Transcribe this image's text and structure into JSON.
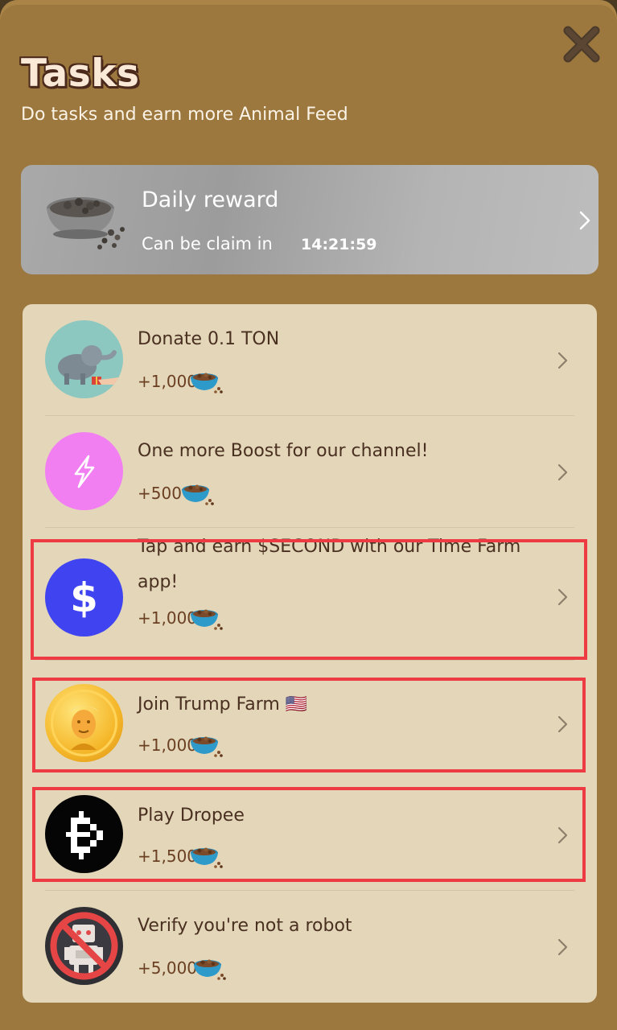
{
  "header": {
    "title": "Tasks",
    "subtitle": "Do tasks and earn more Animal Feed"
  },
  "daily_reward": {
    "title": "Daily reward",
    "subtitle": "Can be claim in",
    "timer": "14:21:59",
    "icon": "pet-food-bowl-icon"
  },
  "tasks": [
    {
      "label": "Donate 0.1 TON",
      "reward": "+1,000",
      "icon": "elephant-gift-icon"
    },
    {
      "label": "One more Boost for our channel!",
      "reward": "+500",
      "icon": "lightning-icon"
    },
    {
      "label": "Tap and earn $SECOND with our Time Farm app!",
      "reward": "+1,000",
      "icon": "dollar-icon"
    },
    {
      "label": "Join Trump Farm 🇺🇸",
      "reward": "+1,000",
      "icon": "trump-coin-icon"
    },
    {
      "label": "Play Dropee",
      "reward": "+1,500",
      "icon": "dropee-logo-icon"
    },
    {
      "label": "Verify you're not a robot",
      "reward": "+5,000",
      "icon": "no-robot-icon"
    }
  ],
  "colors": {
    "background": "#9c773e",
    "card": "#e3d6b9",
    "highlight": "#ee3b43",
    "text": "#4a3020"
  }
}
